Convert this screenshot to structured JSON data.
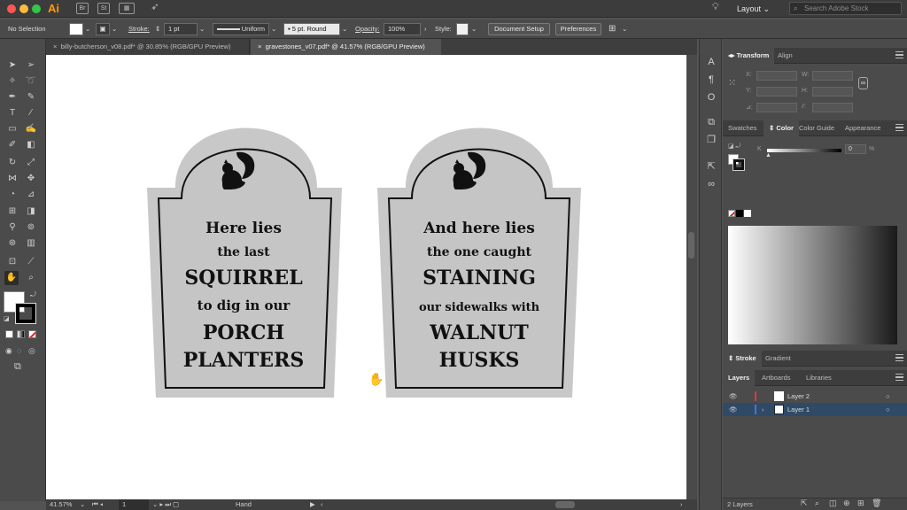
{
  "app": {
    "logo": "Ai",
    "bridge_icon": "Br",
    "stock_icon": "St",
    "workspace": "Layout",
    "search_placeholder": "Search Adobe Stock"
  },
  "control_bar": {
    "selection": "No Selection",
    "stroke_label": "Stroke:",
    "stroke_weight": "1 pt",
    "profile": "Uniform",
    "brush": "5 pt. Round",
    "opacity_label": "Opacity:",
    "opacity_value": "100%",
    "style_label": "Style:",
    "document_setup": "Document Setup",
    "preferences": "Preferences"
  },
  "tabs": [
    {
      "label": "billy-butcherson_v08.pdf* @ 30.85% (RGB/GPU Preview)",
      "active": false
    },
    {
      "label": "gravestones_v07.pdf* @ 41.57% (RGB/GPU Preview)",
      "active": true
    }
  ],
  "gravestones": [
    {
      "lines": [
        "Here lies",
        "the last",
        "SQUIRREL",
        "to dig in our",
        "PORCH",
        "PLANTERS"
      ]
    },
    {
      "lines": [
        "And here lies",
        "the one caught",
        "STAINING",
        "our sidewalks with",
        "WALNUT",
        "HUSKS"
      ]
    }
  ],
  "status_bar": {
    "zoom": "41.57%",
    "artboard": "1",
    "tool": "Hand"
  },
  "transform_panel": {
    "tabs": [
      "Transform",
      "Align"
    ],
    "x_label": "X:",
    "y_label": "Y:",
    "w_label": "W:",
    "h_label": "H:"
  },
  "color_panel": {
    "tabs": [
      "Swatches",
      "Color",
      "Color Guide",
      "Appearance"
    ],
    "channel": "K",
    "value": "0",
    "unit": "%"
  },
  "stroke_panel": {
    "tabs": [
      "Stroke",
      "Gradient"
    ]
  },
  "layers_panel": {
    "tabs": [
      "Layers",
      "Artboards",
      "Libraries"
    ],
    "layers": [
      {
        "name": "Layer 2",
        "color": "#e0383f",
        "selected": false,
        "expandable": false
      },
      {
        "name": "Layer 1",
        "color": "#4a6fe0",
        "selected": true,
        "expandable": true
      }
    ],
    "count": "2 Layers"
  },
  "colors": {
    "accent": "#ff9a00",
    "grave_outer": "#c8c8c8",
    "grave_inner": "#c4c4c4",
    "layer_selected": "#2f4a66"
  }
}
